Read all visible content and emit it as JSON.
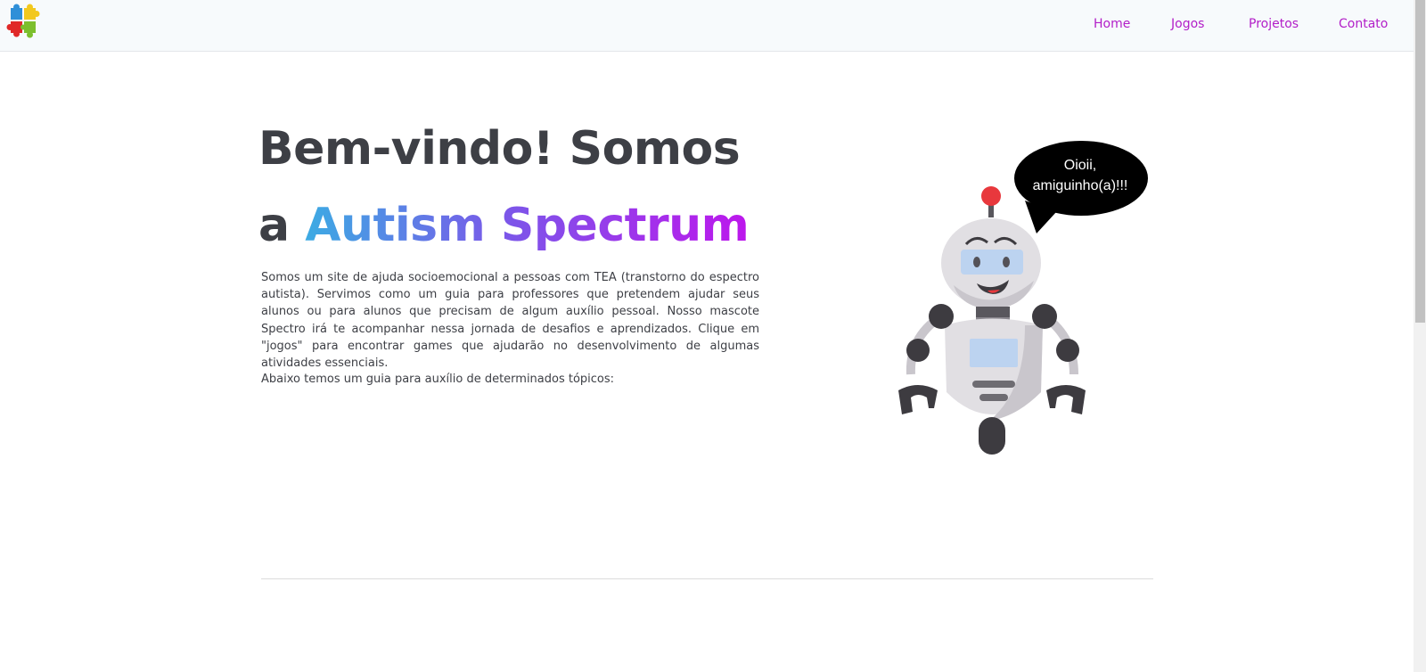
{
  "header": {
    "nav": [
      "Home",
      "Jogos",
      "Projetos",
      "Contato"
    ]
  },
  "hero": {
    "headline_line1": "Bem-vindo! Somos",
    "headline_a": "a",
    "headline_brand": "Autism Spectrum",
    "intro": "Somos um site de ajuda socioemocional a pessoas com TEA (transtorno do espectro autista). Servimos como um guia para professores que pretendem ajudar seus alunos ou para alunos que precisam de algum auxílio pessoal. Nosso mascote Spectro irá te acompanhar nessa jornada de desafios e aprendizados. Clique em \"jogos\" para encontrar games que ajudarão no desenvolvimento de algumas atividades essenciais.",
    "guide": "Abaixo temos um guia para auxílio de determinados tópicos:"
  },
  "mascot": {
    "speech_line1": "Oioii,",
    "speech_line2": "amiguinho(a)!!!"
  },
  "colors": {
    "nav_link": "#b21ec8",
    "text": "#3d3f45",
    "brand_gradient_start": "#3cabe3",
    "brand_gradient_end": "#bd17ec"
  }
}
